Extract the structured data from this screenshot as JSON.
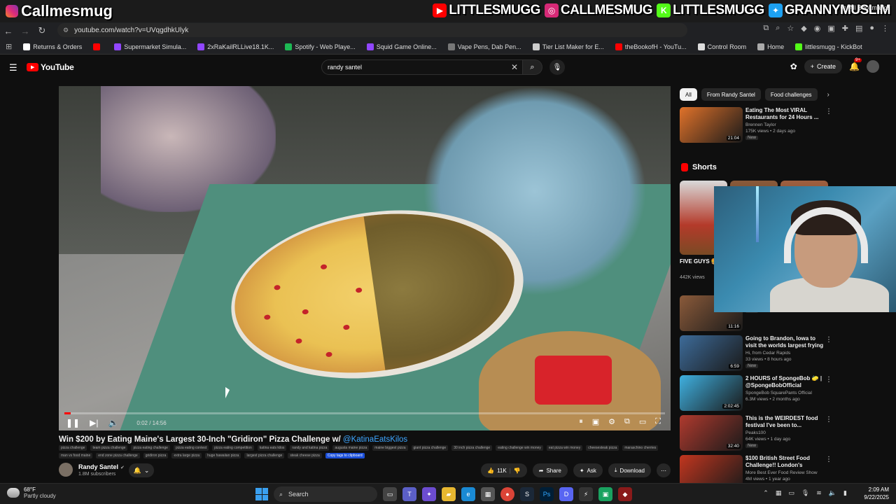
{
  "overlay": {
    "left_name": "Callmesmug",
    "socials": [
      {
        "name": "LITTLESMUGG",
        "icon": "youtube-icon",
        "color": "#ff0000",
        "glyph": "▶"
      },
      {
        "name": "CALLMESMUG",
        "icon": "instagram-icon",
        "color": "#d62976",
        "glyph": "◎"
      },
      {
        "name": "LITTLESMUGG",
        "icon": "kick-icon",
        "color": "#53fc18",
        "glyph": "K"
      },
      {
        "name": "GRANNYMUSLIM",
        "icon": "twitter-icon",
        "color": "#1da1f2",
        "glyph": "✦"
      }
    ]
  },
  "browser": {
    "url": "youtube.com/watch?v=UVqgdhkUlyk",
    "bookmarks": [
      {
        "label": "Returns & Orders",
        "color": "#ffffff"
      },
      {
        "label": "",
        "color": "#ff0000"
      },
      {
        "label": "Supermarket Simula...",
        "color": "#9146ff"
      },
      {
        "label": "2xRaKailRLLive18.1K...",
        "color": "#9146ff"
      },
      {
        "label": "Spotify - Web Playe...",
        "color": "#1db954"
      },
      {
        "label": "Squid Game Online...",
        "color": "#9146ff"
      },
      {
        "label": "Vape Pens, Dab Pen...",
        "color": "#777777"
      },
      {
        "label": "Tier List Maker for E...",
        "color": "#cccccc"
      },
      {
        "label": "theBookofH - YouTu...",
        "color": "#ff0000"
      },
      {
        "label": "Control Room",
        "color": "#dddddd"
      },
      {
        "label": "Home",
        "color": "#aaaaaa"
      },
      {
        "label": "littlesmugg - KickBot",
        "color": "#53fc18"
      }
    ],
    "all_bookmarks": "All Bookmarks"
  },
  "youtube": {
    "logo": "YouTube",
    "search_value": "randy santel",
    "create_label": "Create",
    "notif_count": "9+"
  },
  "player": {
    "time": "0:02 / 14:56",
    "progress": 0.002
  },
  "video": {
    "title": "Win $200 by Eating Maine's Largest 30-Inch \"Gridiron\" Pizza Challenge w/ ",
    "mention": "@KatinaEatsKilos",
    "tags": [
      "pizza challenge",
      "team pizza challenge",
      "pizza eating challenge",
      "pizza eating contest",
      "pizza eating competition",
      "katina eats kilos",
      "randy and katina pizza",
      "augusta maine pizza",
      "maine biggest pizza",
      "giant pizza challenge",
      "30 inch pizza challenge",
      "eating challenge win money",
      "eat pizza win money",
      "cheesesteak pizza",
      "maraschino cherries",
      "man vs food maine",
      "end zone pizza challenge",
      "gridiron pizza",
      "extra large pizza",
      "huge hawaiian pizza",
      "largest pizza challenge",
      "steak cheese pizza",
      "Copy tags to clipboard"
    ],
    "channel": "Randy Santel",
    "subscribers": "1.8M subscribers",
    "likes": "11K",
    "share": "Share",
    "ask": "Ask",
    "download": "Download"
  },
  "sidebar": {
    "chips": [
      "All",
      "From Randy Santel",
      "Food challenges"
    ],
    "recs_top": [
      {
        "title": "Eating The Most VIRAL Restaurants for 24 Hours ...",
        "channel": "Brennen Taylor",
        "meta": "175K views • 2 days ago",
        "badge": "New",
        "duration": "21:04",
        "color": "#e0722a"
      }
    ],
    "shorts_label": "Shorts",
    "short": {
      "title": "FIVE GUYS 🍔 #shorts",
      "views": "442K views"
    },
    "recs_bottom": [
      {
        "title": "",
        "channel": "BeardMeatsFood",
        "meta": "2M views • 15 hours ago",
        "badge": "New",
        "duration": "11:16",
        "color": "#8a5a3a"
      },
      {
        "title": "Going to Brandon, Iowa to visit the worlds largest frying pan ...",
        "channel": "Hi, from Cedar Rapids",
        "meta": "33 views • 8 hours ago",
        "badge": "New",
        "duration": "6:59",
        "color": "#3d6b99"
      },
      {
        "title": "2 HOURS of SpongeBob 🧽 | @SpongeBobOfficial",
        "channel": "SpongeBob SquarePants Official",
        "meta": "6.3M views • 2 months ago",
        "badge": "",
        "duration": "2:02:45",
        "color": "#3fb0e0"
      },
      {
        "title": "This is the WEIRDEST food festival I've been to...",
        "channel": "Peaks100",
        "meta": "64K views • 1 day ago",
        "badge": "New",
        "duration": "32:40",
        "color": "#b03a2e"
      },
      {
        "title": "$100 British Street Food Challenge!! London's Borough ...",
        "channel": "More Best Ever Food Review Show",
        "meta": "4M views • 1 year ago",
        "badge": "",
        "duration": "",
        "color": "#c2361f"
      }
    ]
  },
  "taskbar": {
    "temp": "68°F",
    "weather": "Partly cloudy",
    "search": "Search",
    "time": "2:09 AM",
    "date": "9/22/2025"
  }
}
